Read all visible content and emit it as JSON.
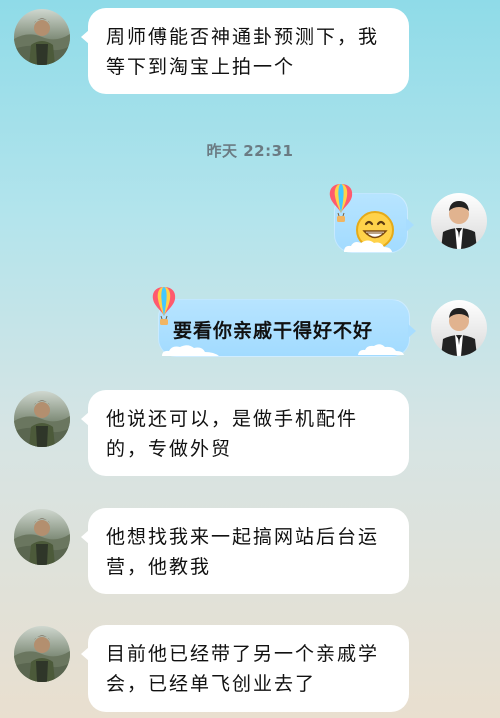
{
  "timestamp": "昨天 22:31",
  "messages": [
    {
      "side": "left",
      "text": "周师傅能否神通卦预测下，我等下到淘宝上拍一个"
    },
    {
      "side": "right",
      "emoji": "laughing-face"
    },
    {
      "side": "right",
      "text": "要看你亲戚干得好不好"
    },
    {
      "side": "left",
      "text": "他说还可以，是做手机配件的，专做外贸"
    },
    {
      "side": "left",
      "text": "他想找我来一起搞网站后台运营，他教我"
    },
    {
      "side": "left",
      "text": "目前他已经带了另一个亲戚学会，已经单飞创业去了"
    }
  ],
  "colors": {
    "background_top": "#8fdbe8",
    "background_bottom": "#e9dfcf",
    "left_bubble": "#ffffff",
    "right_bubble": "#aedfff",
    "timestamp": "#6b7b83"
  },
  "icons": {
    "left_avatar": "man-in-front-of-river-avatar",
    "right_avatar": "man-in-suit-avatar",
    "bubble_decoration": "rainbow-hot-air-balloon",
    "emoji": "grinning-face-emoji"
  }
}
